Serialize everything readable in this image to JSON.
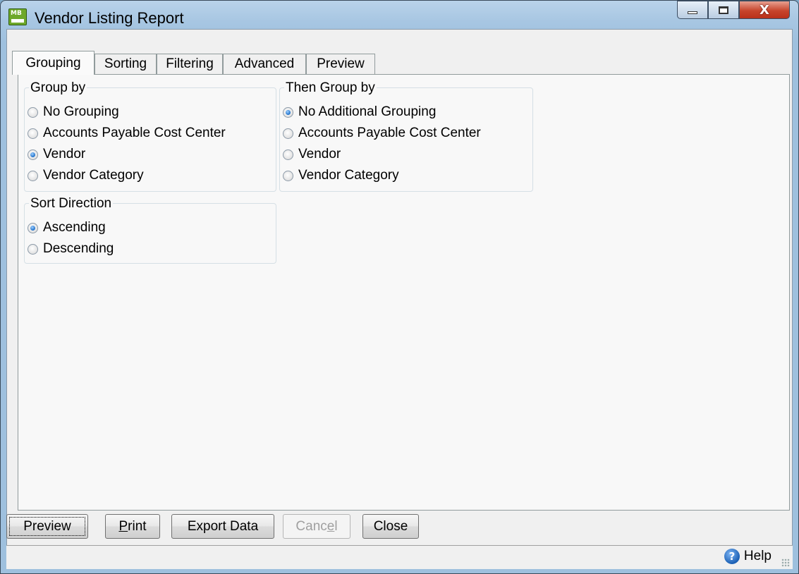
{
  "window": {
    "title": "Vendor Listing Report",
    "icon_text": "MB",
    "controls": {
      "minimize": "—",
      "maximize": "▢",
      "close": "X"
    }
  },
  "tabs": [
    "Grouping",
    "Sorting",
    "Filtering",
    "Advanced",
    "Preview"
  ],
  "active_tab": "Grouping",
  "group_by": {
    "legend": "Group by",
    "options": [
      "No Grouping",
      "Accounts Payable Cost Center",
      "Vendor",
      "Vendor Category"
    ],
    "selected": "Vendor"
  },
  "then_group_by": {
    "legend": "Then Group by",
    "options": [
      "No Additional Grouping",
      "Accounts Payable Cost Center",
      "Vendor",
      "Vendor Category"
    ],
    "selected": "No Additional Grouping"
  },
  "sort_direction": {
    "legend": "Sort Direction",
    "options": [
      "Ascending",
      "Descending"
    ],
    "selected": "Ascending"
  },
  "buttons": {
    "preview": "Preview",
    "print_pre": "",
    "print_u": "P",
    "print_post": "rint",
    "export": "Export Data",
    "cancel_pre": "Canc",
    "cancel_u": "e",
    "cancel_post": "l",
    "close": "Close"
  },
  "status": {
    "help_label": "Help",
    "help_icon": "?"
  }
}
